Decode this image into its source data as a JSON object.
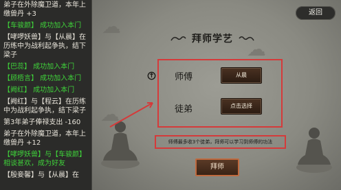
{
  "log": {
    "entries": [
      {
        "text": "弟子在外除魔卫道，本年上缴兽丹 +3",
        "green": false
      },
      {
        "text": "【车骏颜】 成功加入本门",
        "green": true
      },
      {
        "text": "【哮啰妖兽】与【从晨】在历练中为战利起争执，结下梁子",
        "green": false
      },
      {
        "text": "【巴蕊】 成功加入本门",
        "green": true
      },
      {
        "text": "【顾梧言】 成功加入本门",
        "green": true
      },
      {
        "text": "【阙红】 成功加入本门",
        "green": true
      },
      {
        "text": "【阙红】与【程云】在历练中为战利起争执，结下梁子",
        "green": false
      },
      {
        "text": "第3年弟子俸禄支出 -160",
        "green": false
      },
      {
        "text": "弟子在外除魔卫道，本年上缴兽丹 +12",
        "green": false
      },
      {
        "text": "【哮啰妖兽】与【车骏颜】相谈甚欢，成为好友",
        "green": true
      },
      {
        "text": "【殷妾馨】与【从晨】在",
        "green": false
      }
    ]
  },
  "screen": {
    "back_label": "返回",
    "title": "拜师学艺",
    "master_label": "师傅",
    "master_value": "从晨",
    "disciple_label": "徒弟",
    "disciple_value": "点击选择",
    "hint": "师傅最多收3个徒弟，拜师可以学习到师傅的功法",
    "apprentice_label": "拜师"
  },
  "colors": {
    "highlight_red": "#d53a3a",
    "log_green": "#3fd23a",
    "button_brown": "#3a2416"
  }
}
